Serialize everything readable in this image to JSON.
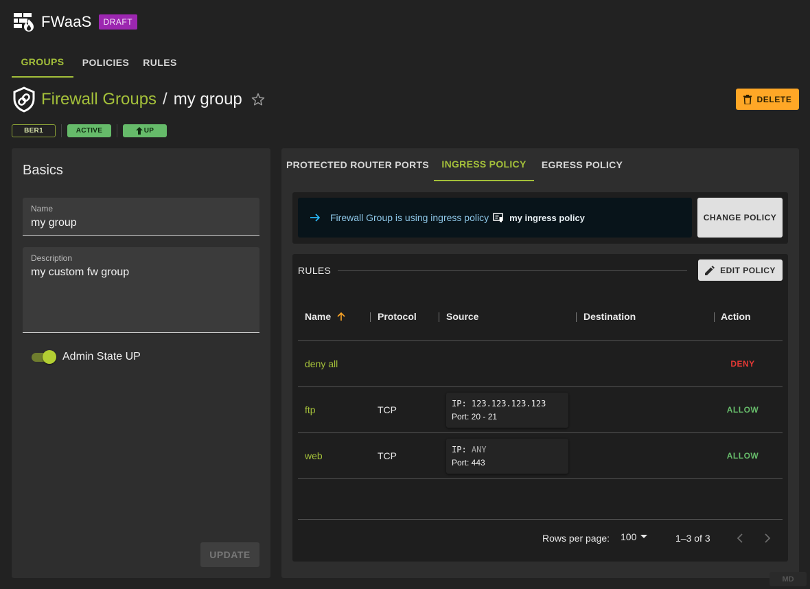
{
  "app": {
    "title": "FWaaS",
    "badge": "DRAFT"
  },
  "top_tabs": [
    {
      "label": "GROUPS",
      "active": true
    },
    {
      "label": "POLICIES",
      "active": false
    },
    {
      "label": "RULES",
      "active": false
    }
  ],
  "breadcrumb": {
    "parent": "Firewall Groups",
    "separator": "/",
    "current": "my group"
  },
  "actions": {
    "delete_label": "DELETE"
  },
  "chips": {
    "region": "BER1",
    "status": "ACTIVE",
    "admin": "UP"
  },
  "basics": {
    "title": "Basics",
    "name_label": "Name",
    "name_value": "my group",
    "description_label": "Description",
    "description_value": "my custom fw group",
    "admin_state_label": "Admin State UP",
    "admin_state_on": true,
    "update_label": "UPDATE"
  },
  "policy_tabs": [
    {
      "label": "PROTECTED ROUTER PORTS",
      "active": false
    },
    {
      "label": "INGRESS POLICY",
      "active": true
    },
    {
      "label": "EGRESS POLICY",
      "active": false
    }
  ],
  "policy_info": {
    "message": "Firewall Group is using ingress policy",
    "policy_name": "my ingress policy",
    "change_label": "CHANGE POLICY"
  },
  "rules": {
    "heading": "RULES",
    "edit_label": "EDIT POLICY",
    "columns": [
      "Name",
      "Protocol",
      "Source",
      "Destination",
      "Action"
    ],
    "rows": [
      {
        "name": "deny all",
        "protocol": "",
        "source_ip_label": "",
        "source_ip": "",
        "source_port": "",
        "action": "DENY"
      },
      {
        "name": "ftp",
        "protocol": "TCP",
        "source_ip_label": "IP:",
        "source_ip": "123.123.123.123",
        "source_port": "Port: 20 - 21",
        "action": "ALLOW"
      },
      {
        "name": "web",
        "protocol": "TCP",
        "source_ip_label": "IP:",
        "source_ip": "ANY",
        "source_port": "Port: 443",
        "action": "ALLOW"
      }
    ]
  },
  "pagination": {
    "rows_per_page_label": "Rows per page:",
    "rows_per_page": "100",
    "range": "1–3 of 3"
  },
  "footer": {
    "md_badge": "MD"
  },
  "colors": {
    "accent": "#a4c03a",
    "delete": "#ffa726",
    "draft": "#9c27b0",
    "deny": "#e53935",
    "allow": "#66bb6a",
    "info": "#8ec7e8"
  },
  "icons": [
    "firewall-logo-icon",
    "shield-link-icon",
    "star-outline-icon",
    "trash-icon",
    "arrow-up-icon",
    "arrow-right-icon",
    "policy-doc-icon",
    "pencil-icon",
    "sort-arrow-up-icon",
    "caret-down-icon",
    "chevron-left-icon",
    "chevron-right-icon"
  ]
}
